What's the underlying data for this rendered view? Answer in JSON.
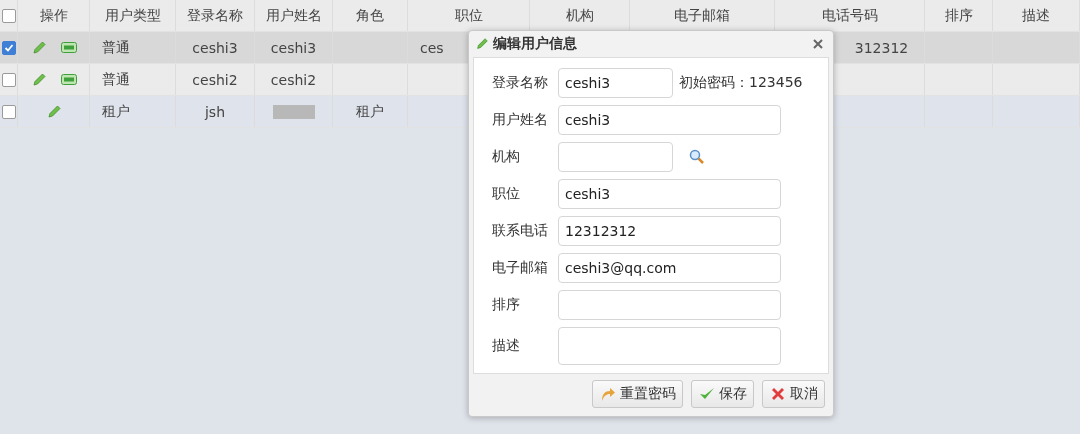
{
  "table": {
    "header_checked": false,
    "columns": [
      "操作",
      "用户类型",
      "登录名称",
      "用户姓名",
      "角色",
      "职位",
      "机构",
      "电子邮箱",
      "电话号码",
      "排序",
      "描述"
    ],
    "rows": [
      {
        "selected": true,
        "tenant": false,
        "cells": [
          {
            "actions": [
              {
                "kind": "edit"
              },
              {
                "kind": "status"
              }
            ]
          },
          "普通",
          "ceshi3",
          "ceshi3",
          "",
          "ces",
          "",
          "",
          "312312",
          "",
          ""
        ]
      },
      {
        "selected": false,
        "tenant": false,
        "cells": [
          {
            "actions": [
              {
                "kind": "edit"
              },
              {
                "kind": "status"
              }
            ]
          },
          "普通",
          "ceshi2",
          "ceshi2",
          "",
          "",
          "",
          "",
          "",
          "",
          ""
        ]
      },
      {
        "selected": false,
        "tenant": true,
        "cells": [
          {
            "actions": [
              {
                "kind": "edit"
              }
            ]
          },
          "租户",
          "jsh",
          {
            "redacted": true
          },
          "租户",
          "",
          "",
          "",
          "",
          "",
          ""
        ]
      }
    ]
  },
  "dialog": {
    "title": "编辑用户信息",
    "fields": [
      {
        "kind": "short",
        "label": "登录名称",
        "value": "ceshi3",
        "note": "初始密码：123456"
      },
      {
        "kind": "text",
        "label": "用户姓名",
        "value": "ceshi3"
      },
      {
        "kind": "lookup",
        "label": "机构"
      },
      {
        "kind": "text",
        "label": "职位",
        "value": "ceshi3"
      },
      {
        "kind": "text",
        "label": "联系电话",
        "value": "12312312"
      },
      {
        "kind": "text",
        "label": "电子邮箱",
        "value": "ceshi3@qq.com"
      },
      {
        "kind": "text",
        "label": "排序"
      },
      {
        "kind": "area",
        "label": "描述"
      }
    ],
    "buttons": [
      {
        "kind": "reset",
        "label": "重置密码"
      },
      {
        "kind": "save",
        "label": "保存"
      },
      {
        "kind": "cancel",
        "label": "取消"
      }
    ]
  }
}
